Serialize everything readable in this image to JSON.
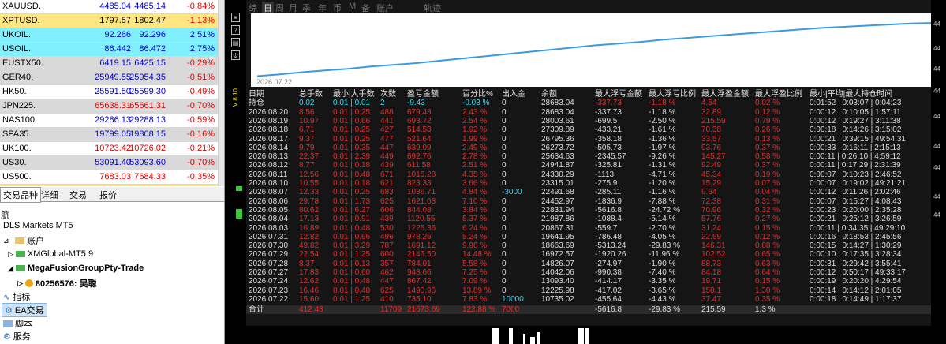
{
  "quotes": [
    {
      "symbol": "XAUUSD.",
      "bid": "4485.04",
      "ask": "4485.14",
      "change": "-0.84%",
      "bg": "#ffffff",
      "bid_color": "#0000cc",
      "ask_color": "#0000cc",
      "chg_color": "#e00000"
    },
    {
      "symbol": "XPTUSD.",
      "bid": "1797.57",
      "ask": "1802.47",
      "change": "-1.13%",
      "bg": "#ffe680",
      "bid_color": "#000000",
      "ask_color": "#000000",
      "chg_color": "#e00000"
    },
    {
      "symbol": "UKOIL.",
      "bid": "92.266",
      "ask": "92.296",
      "change": "2.51%",
      "bg": "#80f0ff",
      "bid_color": "#0000cc",
      "ask_color": "#0000cc",
      "chg_color": "#0000cc"
    },
    {
      "symbol": "USOIL.",
      "bid": "86.442",
      "ask": "86.472",
      "change": "2.75%",
      "bg": "#80f0ff",
      "bid_color": "#0000cc",
      "ask_color": "#0000cc",
      "chg_color": "#0000cc"
    },
    {
      "symbol": "EUSTX50.",
      "bid": "6419.15",
      "ask": "6425.15",
      "change": "-0.29%",
      "bg": "#d9d9d9",
      "bid_color": "#0000cc",
      "ask_color": "#0000cc",
      "chg_color": "#e00000"
    },
    {
      "symbol": "GER40.",
      "bid": "25949.55",
      "ask": "25954.35",
      "change": "-0.51%",
      "bg": "#d9d9d9",
      "bid_color": "#0000cc",
      "ask_color": "#0000cc",
      "chg_color": "#e00000"
    },
    {
      "symbol": "HK50.",
      "bid": "25591.50",
      "ask": "25599.30",
      "change": "-0.49%",
      "bg": "#ffffff",
      "bid_color": "#0000cc",
      "ask_color": "#0000cc",
      "chg_color": "#e00000"
    },
    {
      "symbol": "JPN225.",
      "bid": "65638.31",
      "ask": "65661.31",
      "change": "-0.70%",
      "bg": "#d9d9d9",
      "bid_color": "#e00000",
      "ask_color": "#e00000",
      "chg_color": "#e00000"
    },
    {
      "symbol": "NAS100.",
      "bid": "29286.13",
      "ask": "29288.13",
      "change": "-0.59%",
      "bg": "#ffffff",
      "bid_color": "#0000cc",
      "ask_color": "#0000cc",
      "chg_color": "#e00000"
    },
    {
      "symbol": "SPA35.",
      "bid": "19799.05",
      "ask": "19808.15",
      "change": "-0.16%",
      "bg": "#d9d9d9",
      "bid_color": "#0000cc",
      "ask_color": "#0000cc",
      "chg_color": "#e00000"
    },
    {
      "symbol": "UK100.",
      "bid": "10723.42",
      "ask": "10726.02",
      "change": "-0.21%",
      "bg": "#ffffff",
      "bid_color": "#e00000",
      "ask_color": "#e00000",
      "chg_color": "#e00000"
    },
    {
      "symbol": "US30.",
      "bid": "53091.40",
      "ask": "53093.60",
      "change": "-0.70%",
      "bg": "#d9d9d9",
      "bid_color": "#0000cc",
      "ask_color": "#0000cc",
      "chg_color": "#e00000"
    },
    {
      "symbol": "US500.",
      "bid": "7683.03",
      "ask": "7684.33",
      "change": "-0.35%",
      "bg": "#ffffff",
      "bid_color": "#e00000",
      "ask_color": "#e00000",
      "chg_color": "#e00000"
    }
  ],
  "tabs": [
    "交易品种",
    "详细",
    "交易",
    "报价"
  ],
  "navigator": {
    "title": "航",
    "broker": "DLS Markets MT5",
    "accounts_label": "账户",
    "account1": "XMGlobal-MT5 9",
    "account2": "MegaFusionGroupPty-Trade",
    "account2_user": "80256576: 吴聪",
    "indicators": "指标",
    "ea": "EA交易",
    "scripts": "脚本",
    "services": "服务"
  },
  "toolstrip": {
    "label": "V 8.10",
    "buttons": [
      "≡",
      "?",
      "▤",
      "⚙"
    ]
  },
  "panel_tabs": [
    "综",
    "日",
    "周",
    "月",
    "季",
    "年",
    "币",
    "M",
    "备",
    "账户",
    "轨迹"
  ],
  "active_tab": "日",
  "equity_start_date": "2026.07.22",
  "equity_curve": [
    0.05,
    0.08,
    0.12,
    0.15,
    0.18,
    0.22,
    0.25,
    0.28,
    0.32,
    0.36,
    0.4,
    0.44,
    0.48,
    0.52,
    0.56,
    0.6,
    0.63,
    0.66,
    0.7,
    0.73,
    0.76,
    0.79,
    0.82,
    0.85,
    0.88,
    0.91,
    0.93,
    0.95,
    0.97,
    0.99,
    1.0
  ],
  "table_headers": [
    "日期",
    "总手数",
    "最小|大手数",
    "次数",
    "盈亏金额",
    "百分比%",
    "出入金",
    "余额",
    "最大浮亏金额",
    "最大浮亏比例",
    "最大浮盈金额",
    "最大浮盈比例",
    "最小|平均|最大持仓时间"
  ],
  "holding_row": [
    "持仓",
    "0.02",
    "0.01 | 0.01",
    "2",
    "-9.43",
    "-0.03 %",
    "0",
    "28683.04",
    "-337.73",
    "-1.18 %",
    "4.54",
    "0.02 %",
    "0:01:52 | 0:03:07 | 0:04:23"
  ],
  "rows": [
    [
      "2026.08.20",
      "8.56",
      "0.01 | 0.25",
      "488",
      "679.43",
      "2.43 %",
      "0",
      "28683.04",
      "-337.73",
      "-1.18 %",
      "32.89",
      "0.12 %",
      "0:00:12 | 0:10:05 | 1:57:11"
    ],
    [
      "2026.08.19",
      "10.97",
      "0.01 | 0.66",
      "441",
      "693.72",
      "2.54 %",
      "0",
      "28003.61",
      "-699.5",
      "-2.50 %",
      "215.59",
      "0.79 %",
      "0:00:12 | 0:19:27 | 3:11:38"
    ],
    [
      "2026.08.18",
      "6.71",
      "0.01 | 0.25",
      "427",
      "514.53",
      "1.92 %",
      "0",
      "27309.89",
      "-433.21",
      "-1.61 %",
      "70.38",
      "0.26 %",
      "0:00:18 | 0:14:26 | 3:15:02"
    ],
    [
      "2026.08.17",
      "9.37",
      "0.01 | 0.25",
      "477",
      "521.64",
      "1.99 %",
      "0",
      "26795.36",
      "-358.18",
      "-1.36 %",
      "33.57",
      "0.13 %",
      "0:00:21 | 0:39:15 | 49:54:31"
    ],
    [
      "2026.08.14",
      "9.79",
      "0.01 | 0.35",
      "447",
      "639.09",
      "2.49 %",
      "0",
      "26273.72",
      "-505.73",
      "-1.97 %",
      "93.76",
      "0.37 %",
      "0:00:33 | 0:16:11 | 2:15:13"
    ],
    [
      "2026.08.13",
      "22.37",
      "0.01 | 2.39",
      "449",
      "692.76",
      "2.78 %",
      "0",
      "25634.63",
      "-2345.57",
      "-9.26 %",
      "145.27",
      "0.58 %",
      "0:00:11 | 0:26:10 | 4:59:12"
    ],
    [
      "2026.08.12",
      "8.77",
      "0.01 | 0.18",
      "439",
      "611.58",
      "2.51 %",
      "0",
      "24941.87",
      "-325.81",
      "-1.31 %",
      "92.49",
      "0.37 %",
      "0:00:11 | 0:17:29 | 2:31:39"
    ],
    [
      "2026.08.11",
      "12.56",
      "0.01 | 0.48",
      "671",
      "1015.28",
      "4.35 %",
      "0",
      "24330.29",
      "-1113",
      "-4.71 %",
      "45.34",
      "0.19 %",
      "0:00:07 | 0:10:23 | 2:46:52"
    ],
    [
      "2026.08.10",
      "10.55",
      "0.01 | 0.18",
      "621",
      "823.33",
      "3.66 %",
      "0",
      "23315.01",
      "-275.9",
      "-1.20 %",
      "15.29",
      "0.07 %",
      "0:00:07 | 0:19:02 | 49:21:21"
    ],
    [
      "2026.08.07",
      "12.33",
      "0.01 | 0.25",
      "683",
      "1036.71",
      "4.84 %",
      "-3000",
      "22491.68",
      "-285.11",
      "-1.16 %",
      "9.64",
      "0.04 %",
      "0:00:12 | 0:11:26 | 2:02:46"
    ],
    [
      "2026.08.06",
      "29.78",
      "0.01 | 1.73",
      "625",
      "1621.03",
      "7.10 %",
      "0",
      "24452.97",
      "-1836.9",
      "-7.88 %",
      "72.38",
      "0.31 %",
      "0:00:07 | 0:15:27 | 4:08:43"
    ],
    [
      "2026.08.05",
      "80.62",
      "0.01 | 6.27",
      "606",
      "844.08",
      "3.84 %",
      "0",
      "22831.94",
      "-5616.8",
      "-24.72 %",
      "70.96",
      "0.32 %",
      "0:00:23 | 0:20:00 | 2:35:28"
    ],
    [
      "2026.08.04",
      "17.13",
      "0.01 | 0.91",
      "439",
      "1120.55",
      "5.37 %",
      "0",
      "21987.86",
      "-1088.4",
      "-5.14 %",
      "57.76",
      "0.27 %",
      "0:00:21 | 0:25:12 | 3:26:59"
    ],
    [
      "2026.08.03",
      "16.89",
      "0.01 | 0.48",
      "530",
      "1225.36",
      "6.24 %",
      "0",
      "20867.31",
      "-559.7",
      "-2.70 %",
      "31.24",
      "0.15 %",
      "0:00:11 | 0:34:35 | 49:29:10"
    ],
    [
      "2026.07.31",
      "12.82",
      "0.01 | 0.66",
      "496",
      "978.26",
      "5.24 %",
      "0",
      "19641.95",
      "-786.48",
      "-4.05 %",
      "22.69",
      "0.12 %",
      "0:00:16 | 0:18:53 | 2:45:56"
    ],
    [
      "2026.07.30",
      "49.82",
      "0.01 | 3.29",
      "787",
      "1691.12",
      "9.96 %",
      "0",
      "18663.69",
      "-5313.24",
      "-29.83 %",
      "146.31",
      "0.88 %",
      "0:00:15 | 0:14:27 | 1:30:29"
    ],
    [
      "2026.07.29",
      "22.54",
      "0.01 | 1.25",
      "600",
      "2146.50",
      "14.48 %",
      "0",
      "16972.57",
      "-1920.26",
      "-11.96 %",
      "102.52",
      "0.65 %",
      "0:00:10 | 0:17:35 | 3:28:34"
    ],
    [
      "2026.07.28",
      "8.37",
      "0.01 | 0.13",
      "357",
      "784.01",
      "5.58 %",
      "0",
      "14826.07",
      "-274.97",
      "-1.90 %",
      "88.73",
      "0.63 %",
      "0:00:31 | 0:29:42 | 3:55:41"
    ],
    [
      "2026.07.27",
      "17.83",
      "0.01 | 0.60",
      "462",
      "948.66",
      "7.25 %",
      "0",
      "14042.06",
      "-990.38",
      "-7.40 %",
      "84.18",
      "0.64 %",
      "0:00:12 | 0:50:17 | 49:33:17"
    ],
    [
      "2026.07.24",
      "12.62",
      "0.01 | 0.48",
      "447",
      "867.42",
      "7.09 %",
      "0",
      "13093.40",
      "-414.17",
      "-3.35 %",
      "19.71",
      "0.15 %",
      "0:00:19 | 0:20:20 | 4:29:54"
    ],
    [
      "2026.07.23",
      "16.46",
      "0.01 | 0.48",
      "625",
      "1490.96",
      "13.89 %",
      "0",
      "12225.98",
      "-417.02",
      "-3.65 %",
      "150.1",
      "1.30 %",
      "0:00:14 | 0:14:12 | 2:01:05"
    ],
    [
      "2026.07.22",
      "15.60",
      "0.01 | 1.25",
      "410",
      "735.10",
      "7.83 %",
      "10000",
      "10735.02",
      "-455.64",
      "-4.43 %",
      "37.47",
      "0.35 %",
      "0:00:18 | 0:14:49 | 1:17:37"
    ]
  ],
  "total_row": [
    "合计",
    "412.48",
    "",
    "11709",
    "21673.69",
    "122.88 %",
    "7000",
    "",
    "-5616.8",
    "-29.83 %",
    "215.59",
    "1.3 %",
    ""
  ],
  "right_axis": [
    "44",
    "44",
    "44",
    "44",
    "44",
    "44",
    "44",
    "44",
    "44"
  ]
}
